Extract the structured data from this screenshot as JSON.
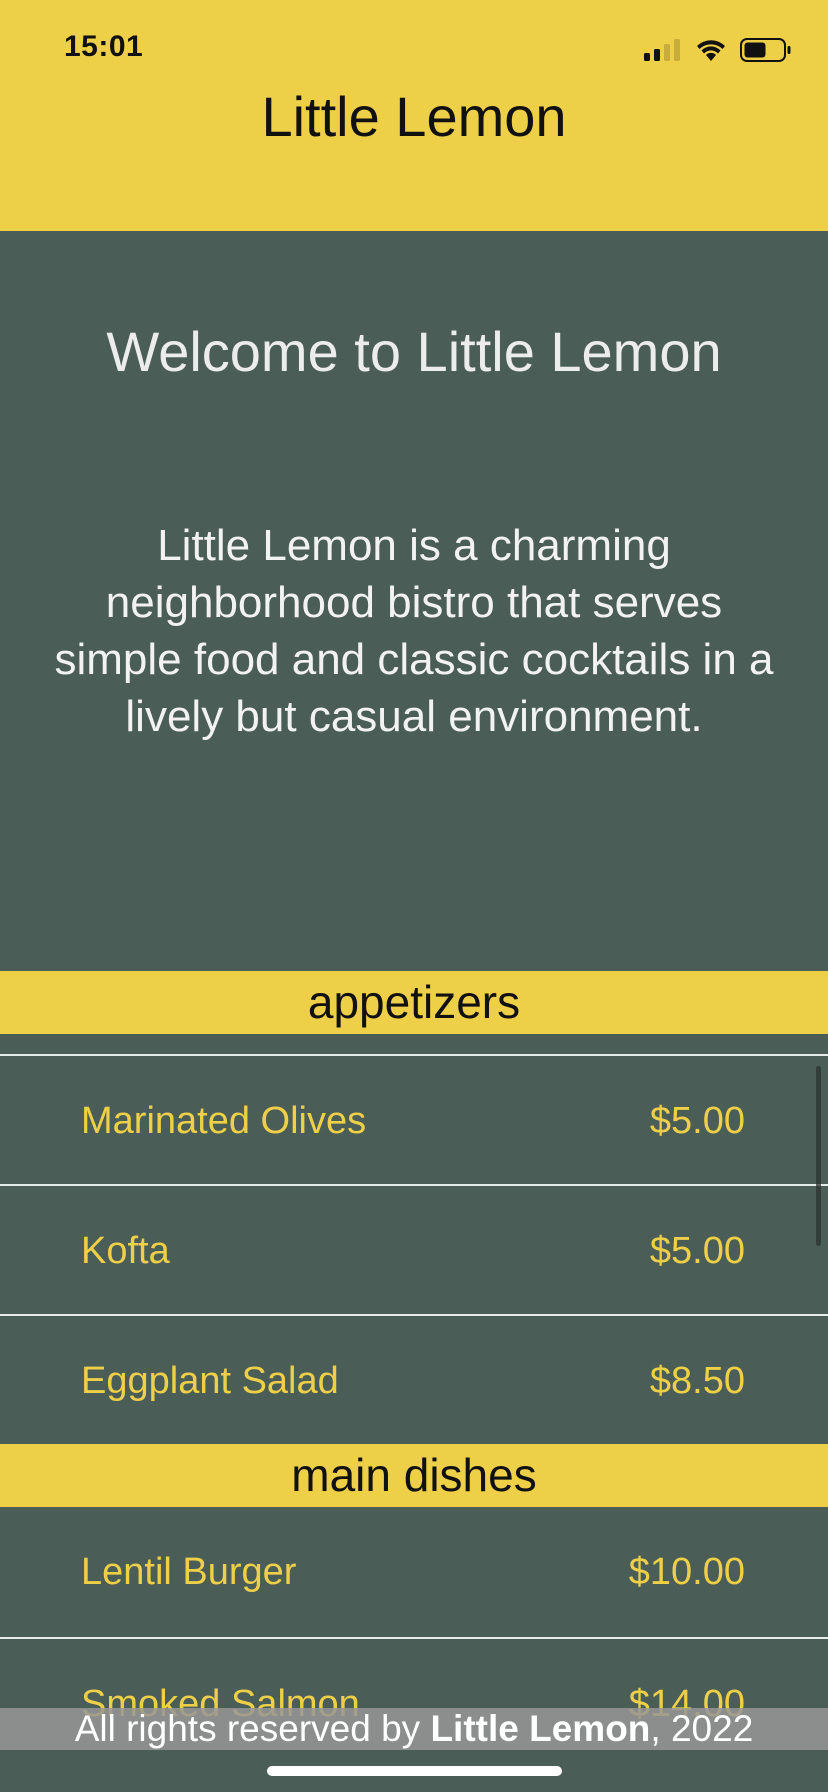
{
  "status_bar": {
    "time": "15:01",
    "icons": [
      "cellular-signal-icon",
      "wifi-icon",
      "battery-icon"
    ]
  },
  "header": {
    "title": "Little Lemon"
  },
  "hero": {
    "title": "Welcome to Little Lemon",
    "description": "Little Lemon is a charming neighborhood bistro that serves simple food and classic cocktails in a lively but casual environment."
  },
  "menu": {
    "sections": [
      {
        "title": "appetizers",
        "items": [
          {
            "name": "Marinated Olives",
            "price": "$5.00"
          },
          {
            "name": "Kofta",
            "price": "$5.00"
          },
          {
            "name": "Eggplant Salad",
            "price": "$8.50"
          }
        ]
      },
      {
        "title": "main dishes",
        "items": [
          {
            "name": "Lentil Burger",
            "price": "$10.00"
          },
          {
            "name": "Smoked Salmon",
            "price": "$14.00"
          }
        ]
      }
    ]
  },
  "footer": {
    "prefix": "All rights reserved by ",
    "brand": "Little Lemon",
    "suffix": ", 2022"
  },
  "colors": {
    "brand_yellow": "#eecf48",
    "brand_green": "#4b5d57",
    "text_light": "#f2f2f2"
  }
}
